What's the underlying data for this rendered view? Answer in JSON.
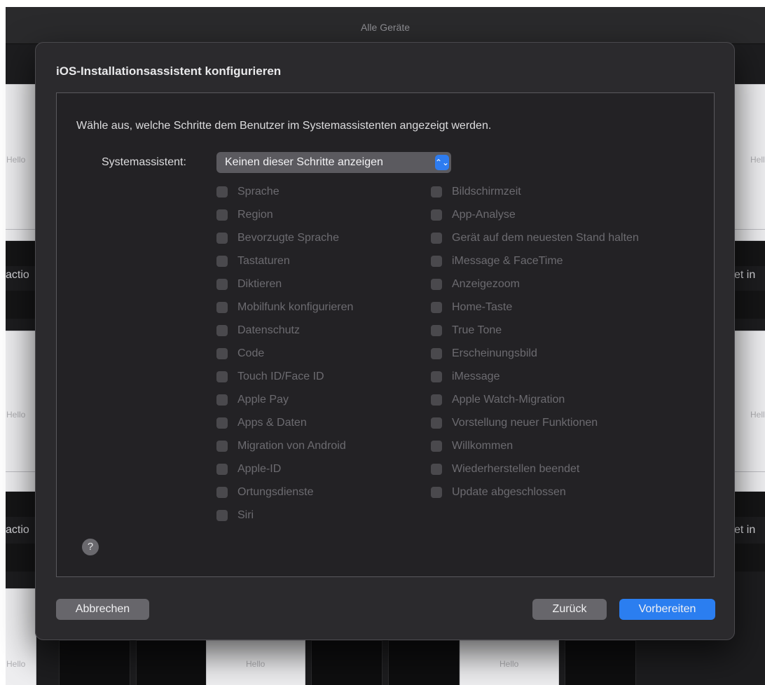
{
  "background": {
    "window_title": "Alle Geräte",
    "card_label": "Hello",
    "action_text_left": "actio",
    "action_text_right": "et in"
  },
  "dialog": {
    "title": "iOS-Installationsassistent konfigurieren",
    "instruction": "Wähle aus, welche Schritte dem Benutzer im Systemassistenten angezeigt werden.",
    "assistant_label": "Systemassistent:",
    "assistant_selected": "Keinen dieser Schritte anzeigen",
    "checkboxes_left": [
      {
        "label": "Sprache",
        "checked": false
      },
      {
        "label": "Region",
        "checked": false
      },
      {
        "label": "Bevorzugte Sprache",
        "checked": false
      },
      {
        "label": "Tastaturen",
        "checked": false
      },
      {
        "label": "Diktieren",
        "checked": false
      },
      {
        "label": "Mobilfunk konfigurieren",
        "checked": false
      },
      {
        "label": "Datenschutz",
        "checked": false
      },
      {
        "label": "Code",
        "checked": false
      },
      {
        "label": "Touch ID/Face ID",
        "checked": false
      },
      {
        "label": "Apple Pay",
        "checked": false
      },
      {
        "label": "Apps & Daten",
        "checked": false
      },
      {
        "label": "Migration von Android",
        "checked": false
      },
      {
        "label": "Apple-ID",
        "checked": false
      },
      {
        "label": "Ortungsdienste",
        "checked": false
      },
      {
        "label": "Siri",
        "checked": false
      }
    ],
    "checkboxes_right": [
      {
        "label": "Bildschirmzeit",
        "checked": false
      },
      {
        "label": "App-Analyse",
        "checked": false
      },
      {
        "label": "Gerät auf dem neuesten Stand halten",
        "checked": false
      },
      {
        "label": "iMessage & FaceTime",
        "checked": false
      },
      {
        "label": "Anzeigezoom",
        "checked": false
      },
      {
        "label": "Home-Taste",
        "checked": false
      },
      {
        "label": "True Tone",
        "checked": false
      },
      {
        "label": "Erscheinungsbild",
        "checked": false
      },
      {
        "label": "iMessage",
        "checked": false
      },
      {
        "label": "Apple Watch-Migration",
        "checked": false
      },
      {
        "label": "Vorstellung neuer Funktionen",
        "checked": false
      },
      {
        "label": "Willkommen",
        "checked": false
      },
      {
        "label": "Wiederherstellen beendet",
        "checked": false
      },
      {
        "label": "Update abgeschlossen",
        "checked": false
      }
    ],
    "help_glyph": "?",
    "buttons": {
      "cancel": "Abbrechen",
      "back": "Zurück",
      "prepare": "Vorbereiten"
    }
  },
  "colors": {
    "accent": "#2b7ef0",
    "dialog_bg": "#2b2a2d"
  }
}
